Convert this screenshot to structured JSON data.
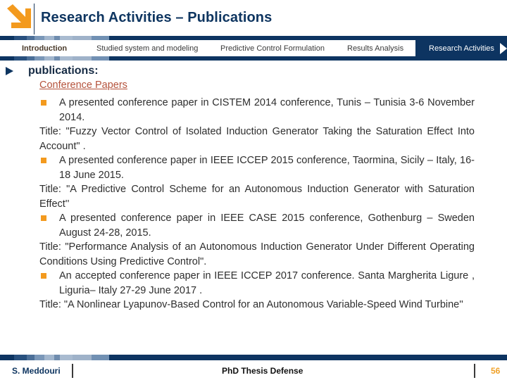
{
  "header": {
    "title": "Research Activities – Publications",
    "logo_icon": "arrow-down-right-icon",
    "brand_colors": {
      "navy": "#0d3461",
      "orange": "#f39a1e"
    }
  },
  "nav": {
    "tabs": [
      {
        "label": "Introduction",
        "active": false
      },
      {
        "label": "Studied system and modeling",
        "active": false
      },
      {
        "label": "Predictive Control Formulation",
        "active": false
      },
      {
        "label": "Results Analysis",
        "active": false
      },
      {
        "label": "Research Activities",
        "active": true
      }
    ]
  },
  "content": {
    "heading": "publications:",
    "subsection": "Conference Papers",
    "entries": [
      {
        "bullet": "A presented conference paper in CISTEM 2014 conference, Tunis – Tunisia 3-6 November 2014.",
        "title": "Title: \"Fuzzy Vector Control of Isolated Induction Generator Taking the Saturation Effect Into Account\" ."
      },
      {
        "bullet": "A presented conference paper in IEEE ICCEP 2015 conference, Taormina, Sicily – Italy, 16-18 June 2015.",
        "title": "Title: \"A Predictive Control Scheme for an Autonomous Induction Generator with Saturation Effect''"
      },
      {
        "bullet": "A presented conference paper in IEEE CASE 2015 conference, Gothenburg – Sweden August 24-28, 2015.",
        "title": "Title: \"Performance Analysis of an Autonomous Induction Generator Under Different Operating Conditions Using Predictive Control\"."
      },
      {
        "bullet": "An accepted conference paper in IEEE ICCEP 2017 conference. Santa Margherita Ligure , Liguria– Italy 27-29 June 2017 .",
        "title": "Title: \"A Nonlinear Lyapunov-Based Control for an Autonomous Variable-Speed Wind Turbine''"
      }
    ]
  },
  "footer": {
    "author": "S. Meddouri",
    "center": "PhD Thesis Defense",
    "page_number": "56"
  }
}
